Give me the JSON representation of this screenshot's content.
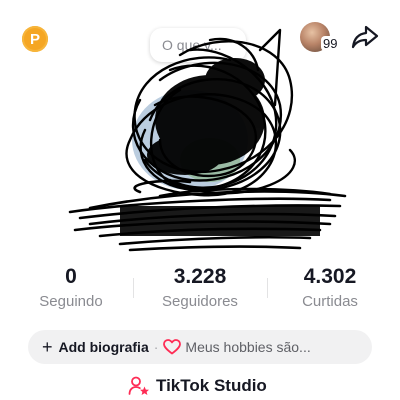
{
  "header": {
    "coin_letter": "P",
    "note_placeholder": "O que v...",
    "friends_count": "99"
  },
  "stats": {
    "following_value": "0",
    "following_label": "Seguindo",
    "followers_value": "3.228",
    "followers_label": "Seguidores",
    "likes_value": "4.302",
    "likes_label": "Curtidas"
  },
  "bio": {
    "plus": "+",
    "add_label": "Add biografia",
    "separator": "·",
    "hobbies_label": "Meus hobbies são..."
  },
  "studio": {
    "label": "TikTok Studio"
  },
  "colors": {
    "coin": "#f5a623",
    "studio_accent": "#fe2c55",
    "heart": "#fe2c55",
    "muted_text": "#8a8b91",
    "pill_bg": "#f1f1f2"
  },
  "icons": {
    "coin": "coin-icon",
    "share": "share-arrow-icon",
    "heart": "heart-outline-icon",
    "studio": "creator-studio-icon"
  }
}
